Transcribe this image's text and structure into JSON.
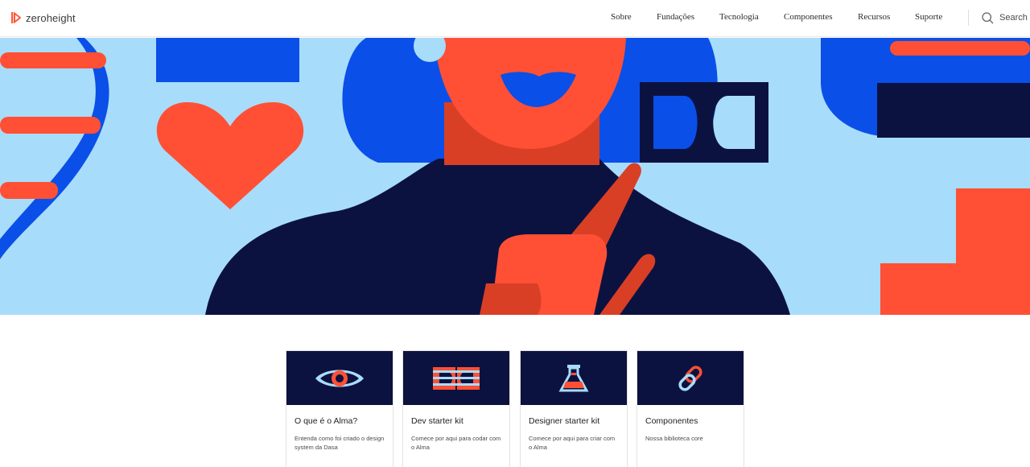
{
  "brand": {
    "name": "zeroheight"
  },
  "nav": {
    "items": [
      {
        "label": "Sobre"
      },
      {
        "label": "Fundações"
      },
      {
        "label": "Tecnologia"
      },
      {
        "label": "Componentes"
      },
      {
        "label": "Recursos"
      },
      {
        "label": "Suporte"
      }
    ]
  },
  "search": {
    "label": "Search"
  },
  "colors": {
    "navy": "#0c1240",
    "coral": "#ff5035",
    "blue": "#0a4fe8",
    "sky": "#a8dcfb",
    "brand_orange": "#ff5a36"
  },
  "cards": [
    {
      "title": "O que é o Alma?",
      "description": "Entenda como foi criado o design system da Dasa",
      "icon": "eye-icon"
    },
    {
      "title": "Dev starter kit",
      "description": "Comece por aqui para codar com o Alma",
      "icon": "dasa-logo-icon"
    },
    {
      "title": "Designer starter kit",
      "description": "Comece por aqui para criar com o Alma",
      "icon": "flask-icon"
    },
    {
      "title": "Componentes",
      "description": "Nossa biblioteca core",
      "icon": "link-icon"
    }
  ]
}
